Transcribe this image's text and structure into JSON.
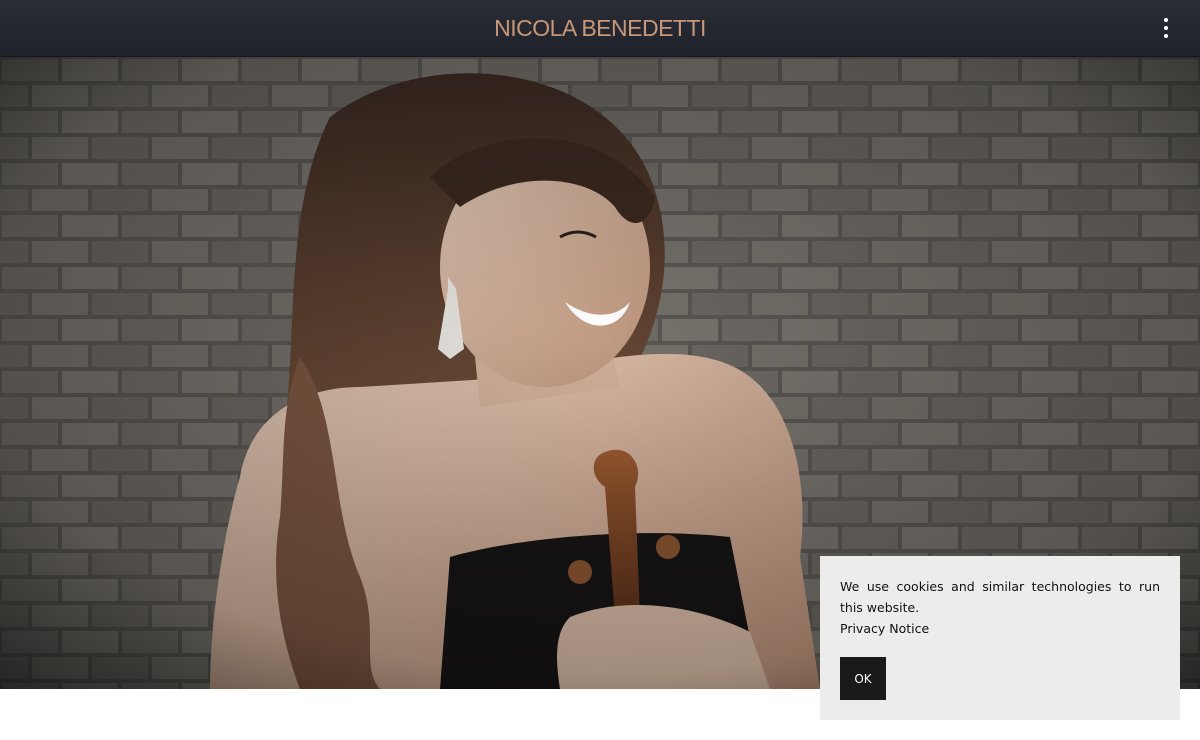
{
  "header": {
    "title": "NICOLA BENEDETTI",
    "title_color": "#c79779",
    "menu_icon": "vertical-ellipsis-icon"
  },
  "hero": {
    "image": "portrait-with-violin"
  },
  "cookie_banner": {
    "message": "We use cookies and similar technologies to run this website.",
    "privacy_link": "Privacy Notice",
    "ok_label": "OK"
  }
}
